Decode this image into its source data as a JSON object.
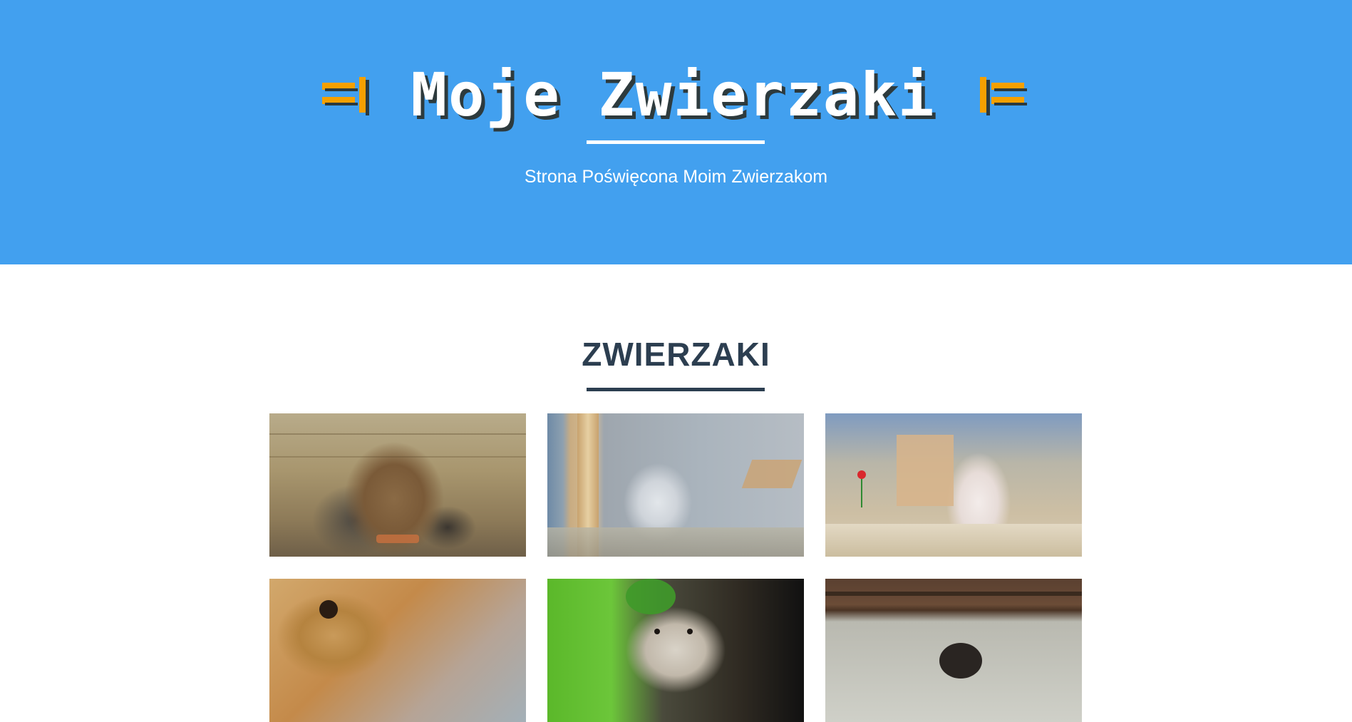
{
  "header": {
    "title": "Moje Zwierzaki",
    "subtitle": "Strona Poświęcona Moim Zwierzakom"
  },
  "section": {
    "title": "ZWIERZAKI"
  },
  "gallery": {
    "items": [
      {
        "name": "hamster-photo-1"
      },
      {
        "name": "hamster-photo-2"
      },
      {
        "name": "hamster-photo-3"
      },
      {
        "name": "hamster-photo-4"
      },
      {
        "name": "hamster-photo-5"
      },
      {
        "name": "hamster-photo-6"
      }
    ]
  },
  "colors": {
    "hero_bg": "#42a0ef",
    "accent_orange": "#f5a000",
    "heading": "#2c3e50",
    "shadow": "#2d3a3d"
  }
}
